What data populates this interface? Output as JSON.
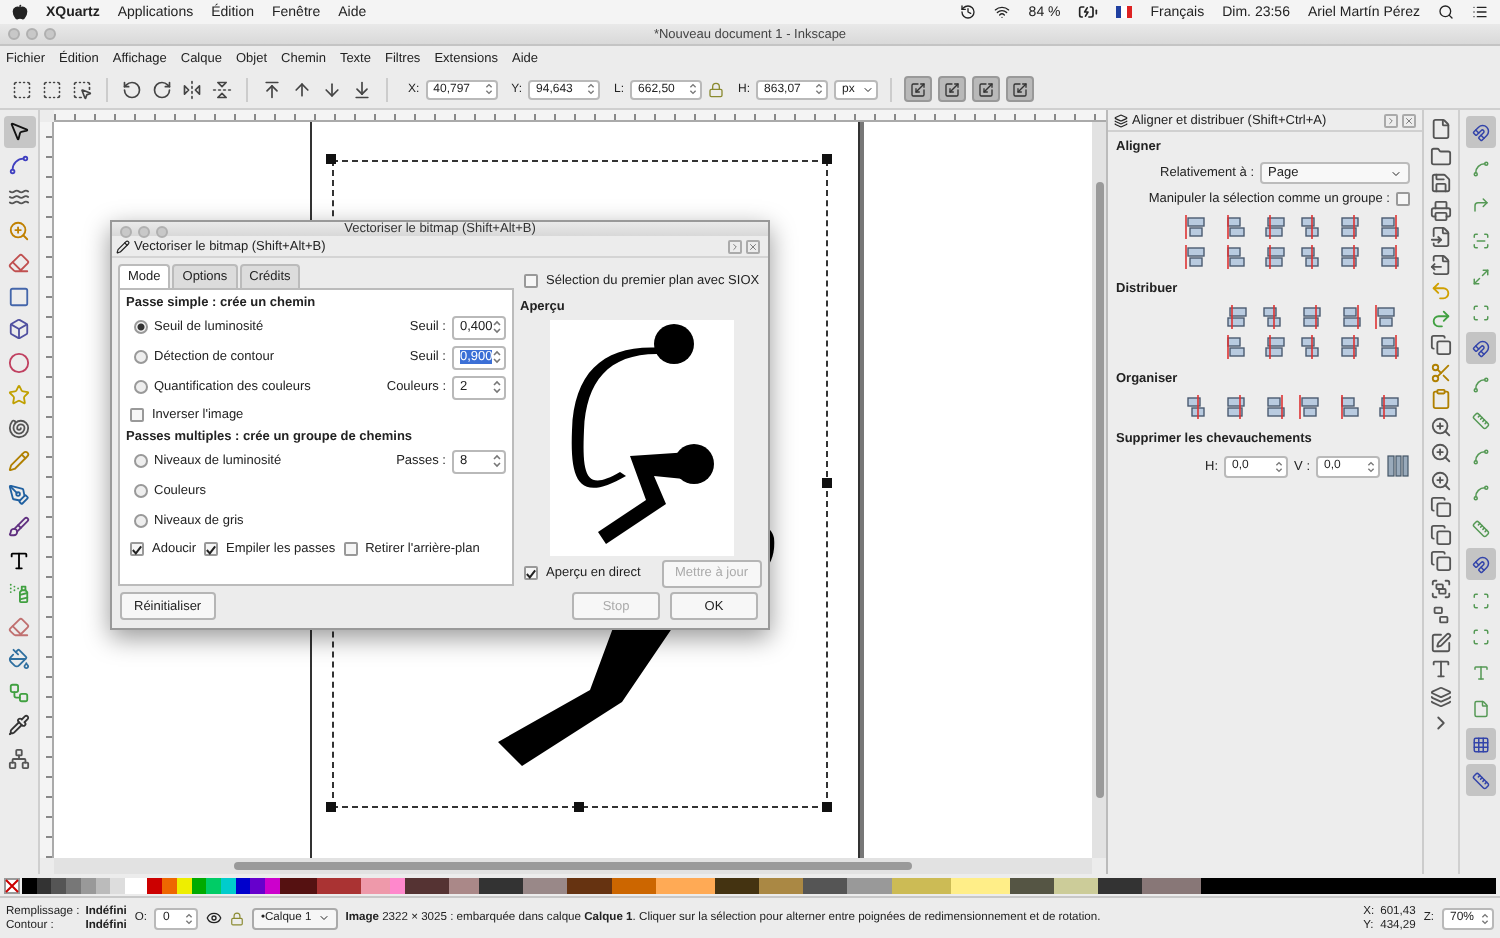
{
  "menubar": {
    "app": "XQuartz",
    "menus": [
      "Applications",
      "Édition",
      "Fenêtre",
      "Aide"
    ],
    "battery": "84 %",
    "language": "Français",
    "clock": "Dim. 23:56",
    "user": "Ariel Martín Pérez"
  },
  "window": {
    "title": "*Nouveau document 1 - Inkscape"
  },
  "menus": [
    "Fichier",
    "Édition",
    "Affichage",
    "Calque",
    "Objet",
    "Chemin",
    "Texte",
    "Filtres",
    "Extensions",
    "Aide"
  ],
  "toolbar": {
    "fields": [
      {
        "label": "X:",
        "value": "40,797"
      },
      {
        "label": "Y:",
        "value": "94,643"
      },
      {
        "label": "L:",
        "value": "662,50"
      },
      {
        "label": "H:",
        "value": "863,07"
      }
    ],
    "unit": "px",
    "transform_toggles": [
      {
        "on": true
      },
      {
        "on": true
      },
      {
        "on": true
      },
      {
        "on": true
      }
    ]
  },
  "tools": [
    {
      "selected": true
    },
    {
      "selected": false
    },
    {
      "selected": false
    },
    {
      "selected": false
    },
    {
      "selected": false
    },
    {
      "selected": false
    },
    {
      "selected": false
    },
    {
      "selected": false
    },
    {
      "selected": false
    },
    {
      "selected": false
    },
    {
      "selected": false
    },
    {
      "selected": false
    },
    {
      "selected": false
    },
    {
      "selected": false
    },
    {
      "selected": false
    },
    {
      "selected": false
    },
    {
      "selected": false
    },
    {
      "selected": false
    },
    {
      "selected": false
    },
    {
      "selected": false
    }
  ],
  "trace_dialog": {
    "window_title": "Vectoriser le bitmap (Shift+Alt+B)",
    "header": "Vectoriser le bitmap (Shift+Alt+B)",
    "tabs": [
      {
        "label": "Mode",
        "selected": true
      },
      {
        "label": "Options",
        "selected": false
      },
      {
        "label": "Crédits",
        "selected": false
      }
    ],
    "sections": [
      {
        "title": "Passe simple : crée un chemin",
        "options": [
          {
            "kind": "radio",
            "label": "Seuil de luminosité",
            "selected": true,
            "field_label": "Seuil :",
            "value": "0,400",
            "highlighted": false
          },
          {
            "kind": "radio",
            "label": "Détection de contour",
            "selected": false,
            "field_label": "Seuil :",
            "value": "0,900",
            "highlighted": true
          },
          {
            "kind": "radio",
            "label": "Quantification des couleurs",
            "selected": false,
            "field_label": "Couleurs :",
            "value": "2",
            "highlighted": false
          },
          {
            "kind": "checkbox",
            "label": "Inverser l'image",
            "checked": false
          }
        ]
      },
      {
        "title": "Passes multiples : crée un groupe de chemins",
        "options": [
          {
            "kind": "radio",
            "label": "Niveaux de luminosité",
            "selected": false,
            "field_label": "Passes :",
            "value": "8",
            "highlighted": false
          },
          {
            "kind": "radio",
            "label": "Couleurs",
            "selected": false
          },
          {
            "kind": "radio",
            "label": "Niveaux de gris",
            "selected": false
          }
        ]
      }
    ],
    "bottom_checks": [
      {
        "label": "Adoucir",
        "checked": true
      },
      {
        "label": "Empiler les passes",
        "checked": true
      },
      {
        "label": "Retirer l'arrière-plan",
        "checked": false
      }
    ],
    "siox": {
      "label": "Sélection du premier plan avec SIOX",
      "checked": false
    },
    "preview_label": "Aperçu",
    "live_preview": {
      "label": "Aperçu en direct",
      "checked": true
    },
    "update_button": {
      "label": "Mettre à jour",
      "disabled": true
    },
    "reset_button": {
      "label": "Réinitialiser",
      "disabled": false
    },
    "actions": [
      {
        "label": "Stop",
        "disabled": true
      },
      {
        "label": "OK",
        "disabled": false
      }
    ]
  },
  "align_panel": {
    "title": "Aligner et distribuer (Shift+Ctrl+A)",
    "align_title": "Aligner",
    "relative_label": "Relativement à :",
    "relative_value": "Page",
    "group_label": "Manipuler la sélection comme un groupe :",
    "group_checked": false,
    "distribute_title": "Distribuer",
    "arrange_title": "Organiser",
    "overlap_title": "Supprimer les chevauchements",
    "h_label": "H:",
    "h_value": "0,0",
    "v_label": "V :",
    "v_value": "0,0"
  },
  "snap_toggles": [
    {
      "on": true
    },
    {
      "on": false
    },
    {
      "on": false
    },
    {
      "on": false
    },
    {
      "on": false
    },
    {
      "on": false
    },
    {
      "on": true
    },
    {
      "on": false
    },
    {
      "on": false
    },
    {
      "on": false
    },
    {
      "on": false
    },
    {
      "on": false
    },
    {
      "on": true
    },
    {
      "on": false
    },
    {
      "on": false
    },
    {
      "on": false
    },
    {
      "on": false
    },
    {
      "on": true
    },
    {
      "on": true
    }
  ],
  "status_bar": {
    "fill_label": "Remplissage :",
    "fill_value": "Indéfini",
    "stroke_label": "Contour :",
    "stroke_value": "Indéfini",
    "opacity_label": "O:",
    "opacity_value": "0",
    "layer": "•Calque 1",
    "message": "**Image** 2322 × 3025 : embarquée dans calque **Calque 1**. Cliquer sur la sélection pour alterner entre poignées de redimensionnement et de rotation.",
    "x_label": "X:",
    "x_value": "601,43",
    "y_label": "Y:",
    "y_value": "434,29",
    "zoom_label": "Z:",
    "zoom_value": "70%"
  }
}
